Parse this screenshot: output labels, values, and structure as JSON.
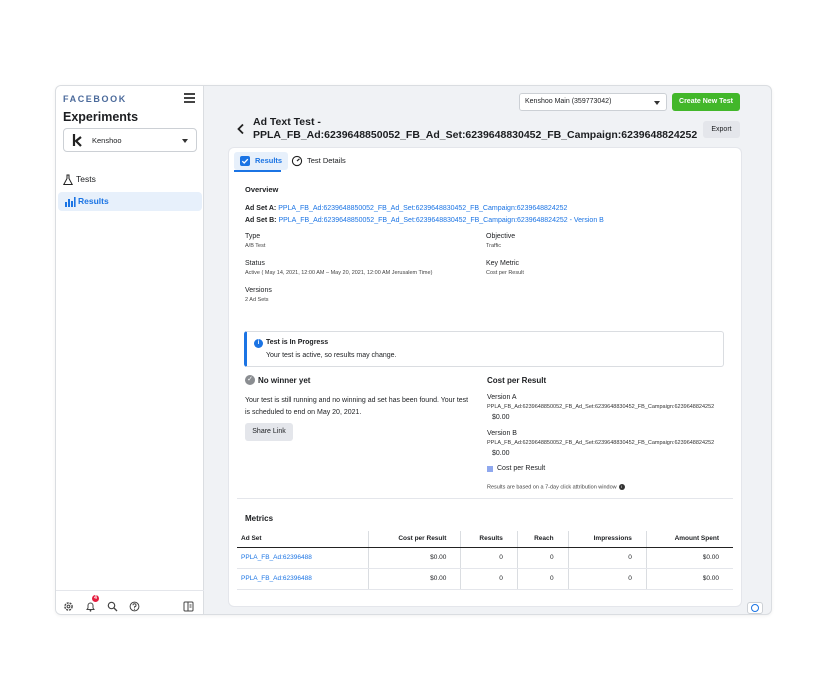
{
  "sidebar": {
    "brand": "FACEBOOK",
    "heading": "Experiments",
    "account_name": "Kenshoo",
    "account_logo": "k-logo",
    "nav": [
      {
        "label": "Tests",
        "icon": "flask-icon"
      },
      {
        "label": "Results",
        "icon": "bar-chart-icon"
      }
    ],
    "footer": {
      "notification_count": "4",
      "icons": [
        "gear-icon",
        "bell-icon",
        "search-icon",
        "help-icon",
        "panel-toggle-icon"
      ]
    }
  },
  "header": {
    "account_select": "Kenshoo Main (359773042)",
    "create_button": "Create New Test",
    "title_line1": "Ad Text Test -",
    "title_line2": "PPLA_FB_Ad:6239648850052_FB_Ad_Set:6239648830452_FB_Campaign:6239648824252",
    "export_button": "Export"
  },
  "tabs": {
    "results": "Results",
    "test_details": "Test Details"
  },
  "overview": {
    "heading": "Overview",
    "ad_set_a_label": "Ad Set A:",
    "ad_set_a": "PPLA_FB_Ad:6239648850052_FB_Ad_Set:6239648830452_FB_Campaign:6239648824252",
    "ad_set_b_label": "Ad Set B:",
    "ad_set_b": "PPLA_FB_Ad:6239648850052_FB_Ad_Set:6239648830452_FB_Campaign:6239648824252 - Version B",
    "type_label": "Type",
    "type_value": "A/B Test",
    "objective_label": "Objective",
    "objective_value": "Traffic",
    "status_label": "Status",
    "status_value": "Active ( May 14, 2021, 12:00 AM – May 20, 2021, 12:00 AM Jerusalem Time)",
    "key_metric_label": "Key Metric",
    "key_metric_value": "Cost per Result",
    "versions_label": "Versions",
    "versions_value": "2 Ad Sets"
  },
  "notice": {
    "title": "Test is In Progress",
    "body": "Your test is active, so results may change."
  },
  "winner": {
    "title": "No winner yet",
    "text": "Your test is still running and no winning ad set has been found. Your test is scheduled to end on May 20, 2021.",
    "share_button": "Share Link"
  },
  "cost_per_result": {
    "title": "Cost per Result",
    "version_a_label": "Version A",
    "version_a_name": "PPLA_FB_Ad:6239648850052_FB_Ad_Set:6239648830452_FB_Campaign:6239648824252",
    "version_a_value": "$0.00",
    "version_b_label": "Version B",
    "version_b_name": "PPLA_FB_Ad:6239648850052_FB_Ad_Set:6239648830452_FB_Campaign:6239648824252",
    "version_b_value": "$0.00",
    "legend": "Cost per Result",
    "legend_color": "#8fa8ee",
    "attribution_note": "Results are based on a 7-day click attribution window"
  },
  "metrics": {
    "title": "Metrics",
    "columns": [
      "Ad Set",
      "Cost per Result",
      "Results",
      "Reach",
      "Impressions",
      "Amount Spent"
    ],
    "rows": [
      [
        "PPLA_FB_Ad:62396488",
        "$0.00",
        "0",
        "0",
        "0",
        "$0.00"
      ],
      [
        "PPLA_FB_Ad:62396488",
        "$0.00",
        "0",
        "0",
        "0",
        "$0.00"
      ]
    ]
  },
  "colors": {
    "accent": "#1b74e4",
    "create_button": "#42b72a",
    "background": "#f0f2f5"
  }
}
